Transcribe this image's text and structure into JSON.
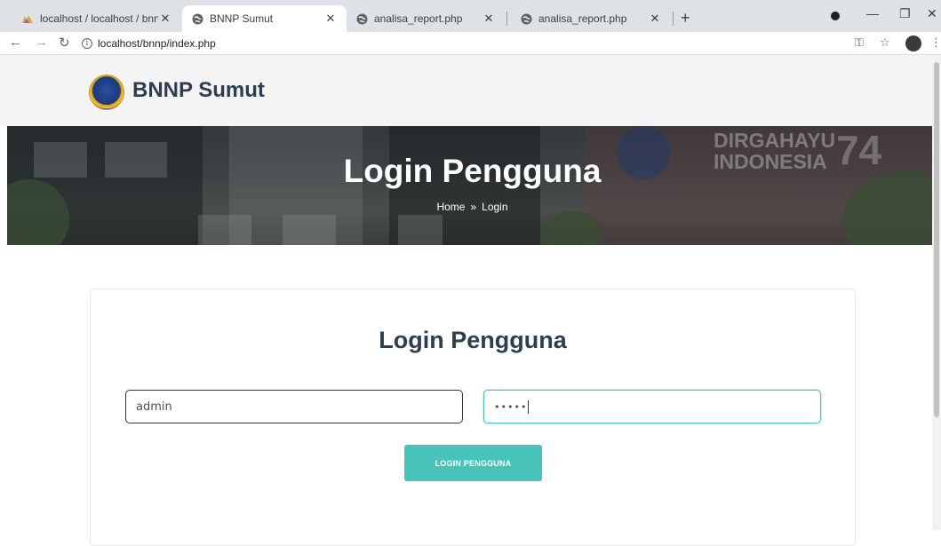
{
  "browser": {
    "tabs": [
      {
        "title": "localhost / localhost / bnnp | php",
        "icon": "phpmyadmin-icon",
        "active": false
      },
      {
        "title": "BNNP Sumut",
        "icon": "globe-icon",
        "active": true
      },
      {
        "title": "analisa_report.php",
        "icon": "globe-icon",
        "active": false
      },
      {
        "title": "analisa_report.php",
        "icon": "globe-icon",
        "active": false
      }
    ],
    "close_glyph": "✕",
    "new_tab_glyph": "+",
    "url": "localhost/bnnp/index.php",
    "info_glyph": "i"
  },
  "site": {
    "name": "BNNP Sumut"
  },
  "hero": {
    "title": "Login Pengguna",
    "breadcrumb": {
      "home": "Home",
      "separator": "»",
      "current": "Login"
    },
    "banner_text_line1": "DIRGAHAYU",
    "banner_text_line2": "INDONESIA",
    "banner_number": "74"
  },
  "login": {
    "title": "Login Pengguna",
    "username_value": "admin",
    "password_value": "•••••",
    "submit_label": "LOGIN PENGGUNA"
  },
  "colors": {
    "accent": "#47c3b9",
    "heading": "#2c3e50"
  }
}
